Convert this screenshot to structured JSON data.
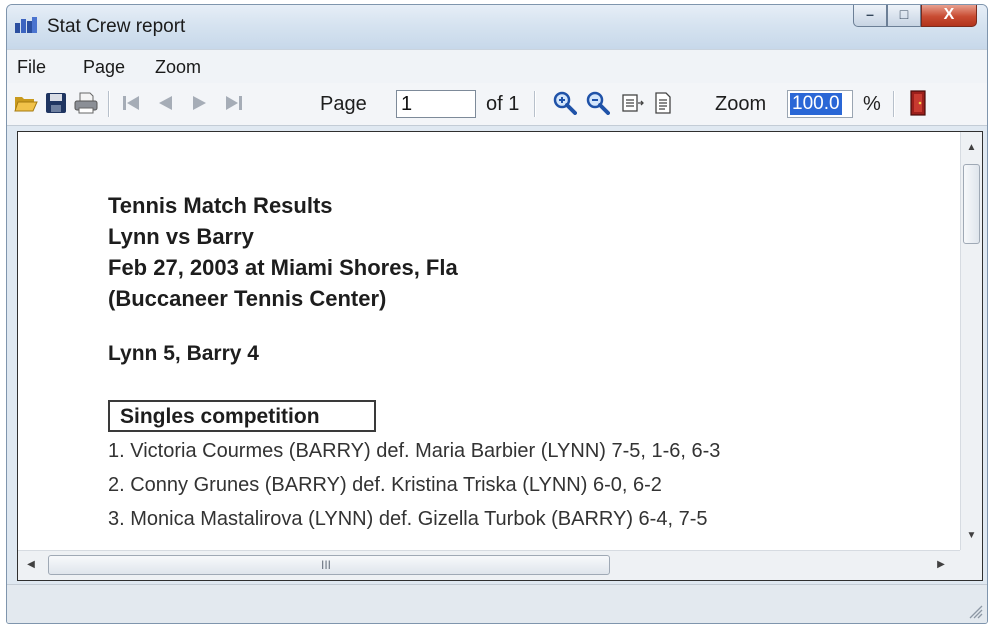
{
  "window": {
    "title": "Stat Crew report",
    "controls": {
      "minimize": "–",
      "maximize": "□",
      "close": "X"
    }
  },
  "menu": {
    "items": [
      "File",
      "Page",
      "Zoom"
    ]
  },
  "toolbar": {
    "icons": [
      "open-folder-icon",
      "save-disk-icon",
      "print-icon",
      "first-page-icon",
      "previous-page-icon",
      "next-page-icon",
      "last-page-icon",
      "zoom-in-icon",
      "zoom-out-icon",
      "fit-width-icon",
      "fit-page-icon",
      "exit-icon"
    ],
    "page_label": "Page",
    "page_value": "1",
    "of_label": "of 1",
    "zoom_label": "Zoom",
    "zoom_value": "100.0",
    "percent_label": "%"
  },
  "report": {
    "heading_lines": [
      "Tennis Match Results",
      "Lynn vs Barry",
      "Feb 27, 2003 at Miami Shores, Fla",
      "(Buccaneer Tennis Center)"
    ],
    "score": "Lynn 5, Barry 4",
    "section_title": "Singles competition",
    "results": [
      "1. Victoria Courmes (BARRY) def. Maria Barbier (LYNN) 7-5, 1-6, 6-3",
      "2. Conny Grunes (BARRY) def. Kristina Triska (LYNN) 6-0, 6-2",
      "3. Monica Mastalirova (LYNN) def. Gizella Turbok (BARRY) 6-4, 7-5"
    ]
  },
  "scrollbar": {
    "grip_glyph": "III"
  }
}
